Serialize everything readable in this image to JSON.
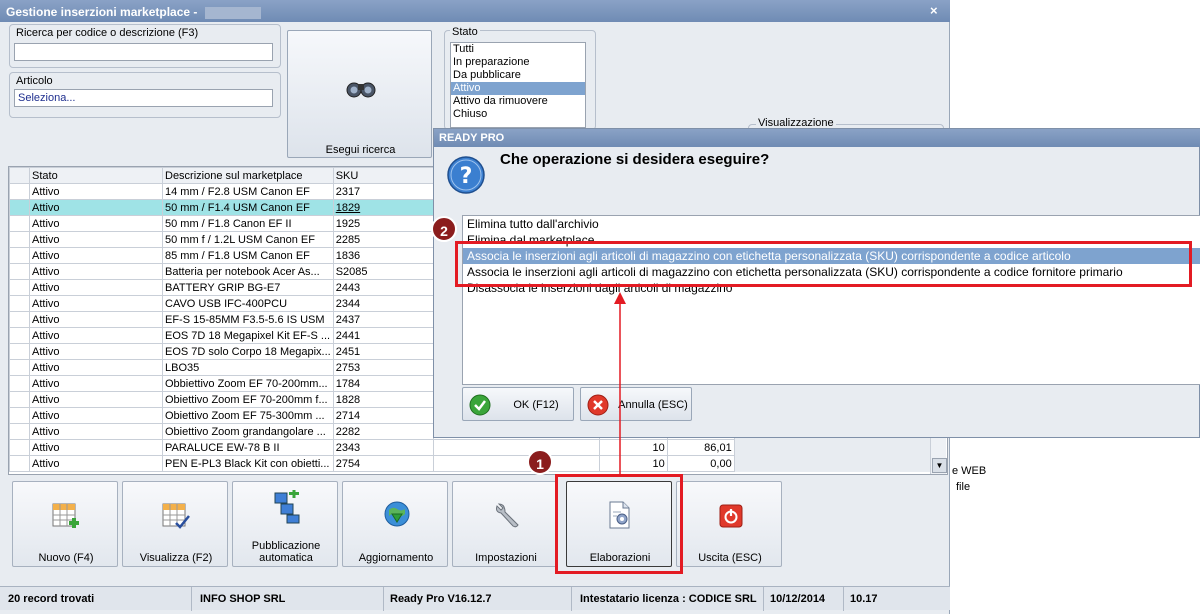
{
  "window": {
    "title": "Gestione inserzioni marketplace -",
    "close": "×"
  },
  "search": {
    "label": "Ricerca per codice o descrizione (F3)",
    "value": ""
  },
  "article": {
    "label": "Articolo",
    "value": "Seleziona..."
  },
  "search_button": {
    "label": "Esegui ricerca"
  },
  "stato": {
    "label": "Stato",
    "items": [
      "Tutti",
      "In preparazione",
      "Da pubblicare",
      "Attivo",
      "Attivo da rimuovere",
      "Chiuso"
    ],
    "selected": "Attivo"
  },
  "view": {
    "label": "Visualizzazione"
  },
  "table": {
    "headers": [
      "Stato",
      "Descrizione sul marketplace",
      "SKU"
    ],
    "rows": [
      [
        "Attivo",
        "14 mm / F2.8 USM Canon EF",
        "2317"
      ],
      [
        "Attivo",
        "50 mm / F1.4 USM Canon EF",
        "1829"
      ],
      [
        "Attivo",
        "50 mm / F1.8 Canon EF II",
        "1925"
      ],
      [
        "Attivo",
        "50 mm f / 1.2L USM Canon EF",
        "2285"
      ],
      [
        "Attivo",
        "85 mm / F1.8 USM Canon EF",
        "1836"
      ],
      [
        "Attivo",
        "Batteria per notebook Acer As...",
        "S2085"
      ],
      [
        "Attivo",
        "BATTERY GRIP BG-E7",
        "2443"
      ],
      [
        "Attivo",
        "CAVO USB IFC-400PCU",
        "2344"
      ],
      [
        "Attivo",
        "EF-S 15-85MM F3.5-5.6 IS USM",
        "2437"
      ],
      [
        "Attivo",
        "EOS 7D 18 Megapixel Kit EF-S ...",
        "2441"
      ],
      [
        "Attivo",
        "EOS 7D solo Corpo 18 Megapix...",
        "2451"
      ],
      [
        "Attivo",
        "LBO35",
        "2753"
      ],
      [
        "Attivo",
        "Obbiettivo Zoom EF 70-200mm...",
        "1784"
      ],
      [
        "Attivo",
        "Obiettivo Zoom EF 70-200mm f...",
        "1828"
      ],
      [
        "Attivo",
        "Obiettivo Zoom EF 75-300mm ...",
        "2714"
      ],
      [
        "Attivo",
        "Obiettivo Zoom grandangolare ...",
        "2282"
      ],
      [
        "Attivo",
        "PARALUCE EW-78 B II",
        "2343"
      ],
      [
        "Attivo",
        "PEN E-PL3 Black Kit con obietti...",
        "2754"
      ]
    ],
    "extra_rows": [
      {
        "qty": "10",
        "price": "86,01"
      },
      {
        "qty": "10",
        "price": "0,00"
      }
    ]
  },
  "toolbar": {
    "new": "Nuovo (F4)",
    "view": "Visualizza (F2)",
    "publish": "Pubblicazione automatica",
    "update": "Aggiornamento",
    "settings": "Impostazioni",
    "process": "Elaborazioni",
    "exit": "Uscita (ESC)"
  },
  "status": {
    "records": "20 record trovati",
    "company": "INFO SHOP SRL",
    "version": "Ready Pro V16.12.7",
    "license": "Intestatario licenza : CODICE SRL",
    "date": "10/12/2014",
    "time": "10.17"
  },
  "bg_text": {
    "web": "e WEB",
    "file": "file"
  },
  "dialog": {
    "title": "READY PRO",
    "question": "Che operazione si desidera eseguire?",
    "options": [
      "Elimina tutto dall'archivio",
      "Elimina dal marketplace",
      "Associa le inserzioni agli articoli di magazzino con etichetta personalizzata (SKU) corrispondente a codice articolo",
      "Associa le inserzioni agli articoli di magazzino con etichetta personalizzata (SKU) corrispondente a codice fornitore primario",
      "Disassocia le inserzioni dagli articoli di magazzino"
    ],
    "selected_index": 2,
    "ok": "OK (F12)",
    "cancel": "Annulla (ESC)"
  },
  "annotations": {
    "step1": "1",
    "step2": "2",
    "accent": "#e31b23"
  }
}
